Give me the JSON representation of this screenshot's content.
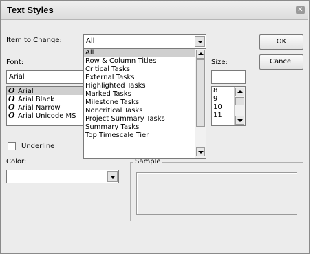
{
  "dialog": {
    "title": "Text Styles"
  },
  "item_to_change": {
    "label": "Item to Change:",
    "value": "All",
    "options": [
      "All",
      "Row & Column Titles",
      "Critical Tasks",
      "External Tasks",
      "Highlighted Tasks",
      "Marked Tasks",
      "Milestone Tasks",
      "Noncritical Tasks",
      "Project Summary Tasks",
      "Summary Tasks",
      "Top Timescale Tier"
    ]
  },
  "buttons": {
    "ok": "OK",
    "cancel": "Cancel"
  },
  "font": {
    "label": "Font:",
    "value": "Arial",
    "list": [
      "Arial",
      "Arial Black",
      "Arial Narrow",
      "Arial Unicode MS"
    ],
    "icon_glyph": "O"
  },
  "size": {
    "label": "Size:",
    "value": "",
    "list": [
      "8",
      "9",
      "10",
      "11"
    ]
  },
  "underline": {
    "label": "Underline",
    "checked": false
  },
  "color": {
    "label": "Color:",
    "value": ""
  },
  "sample": {
    "label": "Sample"
  }
}
